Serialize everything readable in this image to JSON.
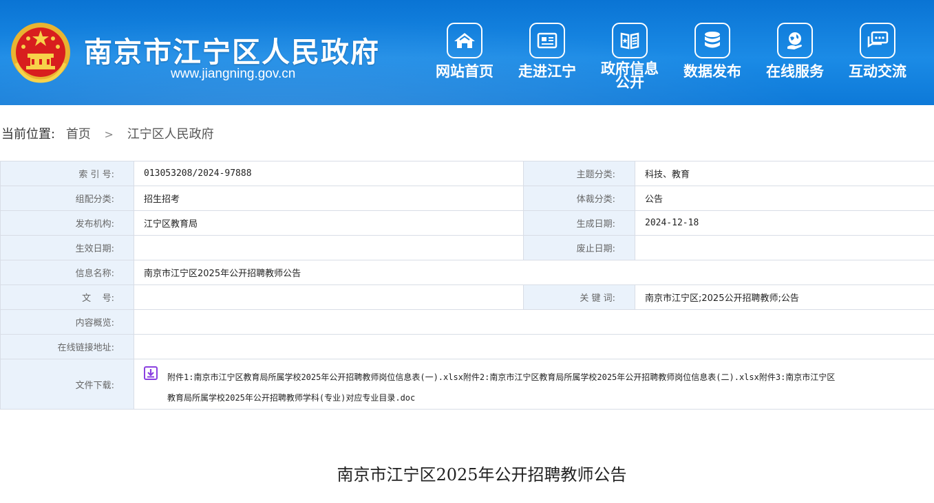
{
  "header": {
    "site_title": "南京市江宁区人民政府",
    "site_url": "www.jiangning.gov.cn",
    "nav": [
      {
        "label": "网站首页",
        "icon": "home-icon"
      },
      {
        "label": "走进江宁",
        "icon": "newspaper-icon"
      },
      {
        "label_line1": "政府信息",
        "label_line2": "公开",
        "icon": "book-icon"
      },
      {
        "label": "数据发布",
        "icon": "database-icon"
      },
      {
        "label": "在线服务",
        "icon": "globe-hand-icon"
      },
      {
        "label": "互动交流",
        "icon": "chat-icon"
      }
    ],
    "colors": {
      "banner": "#1a86e0",
      "text": "#ffffff"
    }
  },
  "breadcrumb": {
    "label": "当前位置:",
    "items": [
      "首页",
      "江宁区人民政府"
    ],
    "separator": ">"
  },
  "info": {
    "index_label": "索 引 号:",
    "index_value": "013053208/2024-97888",
    "topic_label": "主题分类:",
    "topic_value": "科技、教育",
    "org_label": "组配分类:",
    "org_value": "招生招考",
    "genre_label": "体裁分类:",
    "genre_value": "公告",
    "publisher_label": "发布机构:",
    "publisher_value": "江宁区教育局",
    "created_label": "生成日期:",
    "created_value": "2024-12-18",
    "effective_label": "生效日期:",
    "effective_value": "",
    "abolished_label": "废止日期:",
    "abolished_value": "",
    "name_label": "信息名称:",
    "name_value": "南京市江宁区2025年公开招聘教师公告",
    "docno_label": "文    号:",
    "docno_value": "",
    "keywords_label": "关 键 词:",
    "keywords_value": "南京市江宁区;2025公开招聘教师;公告",
    "summary_label": "内容概览:",
    "summary_value": "",
    "link_label": "在线链接地址:",
    "link_value": "",
    "download_label": "文件下载:",
    "download_line1": "附件1:南京市江宁区教育局所属学校2025年公开招聘教师岗位信息表(一).xlsx附件2:南京市江宁区教育局所属学校2025年公开招聘教师岗位信息表(二).xlsx附件3:南京市江宁区",
    "download_line2": "教育局所属学校2025年公开招聘教师学科(专业)对应专业目录.doc"
  },
  "article": {
    "title": "南京市江宁区2025年公开招聘教师公告"
  }
}
